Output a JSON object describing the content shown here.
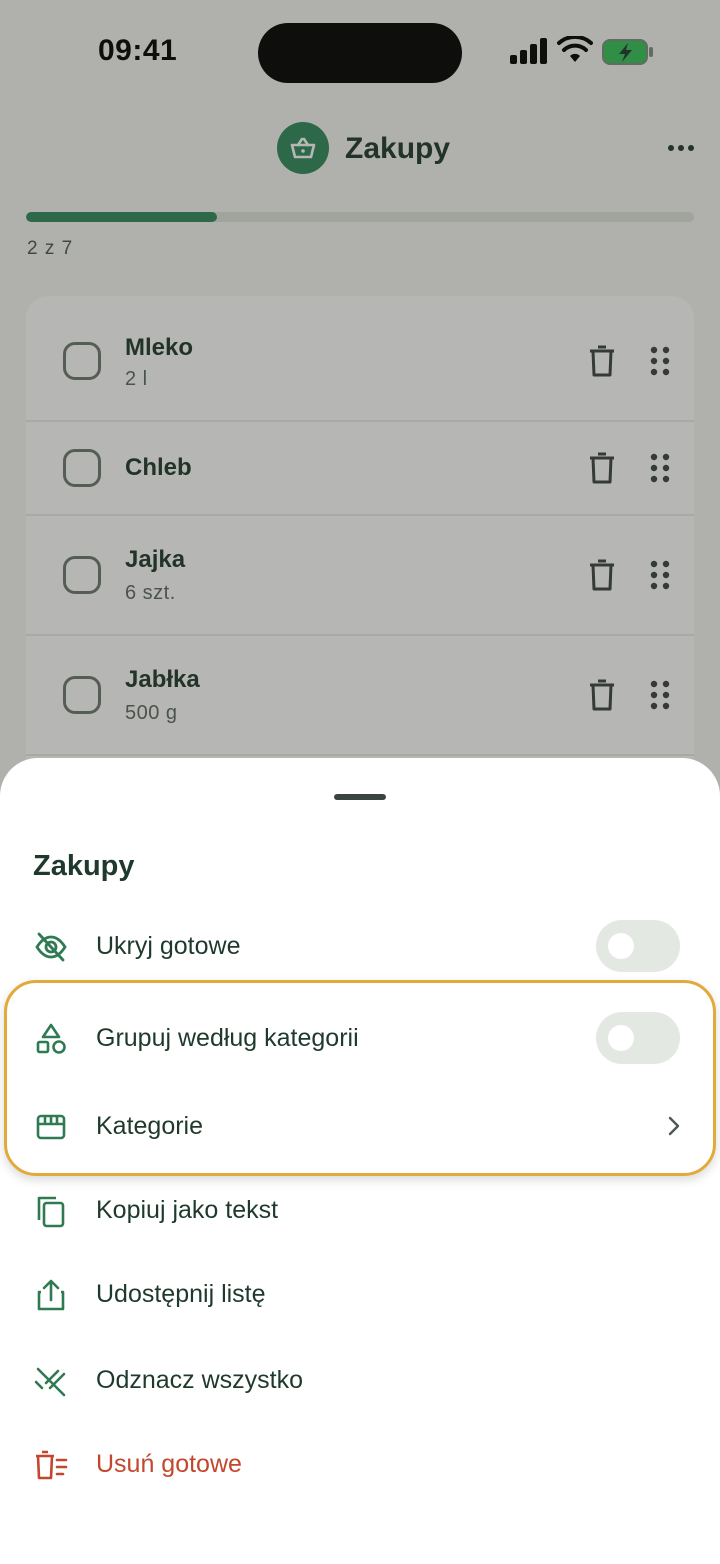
{
  "status_bar": {
    "time": "09:41",
    "icons": [
      "signal-icon",
      "wifi-icon",
      "battery-charging-icon"
    ]
  },
  "header": {
    "title": "Zakupy",
    "icon": "basket-icon",
    "menu_icon": "more-horizontal-icon"
  },
  "progress": {
    "text": "2 z 7",
    "done": 2,
    "total": 7
  },
  "list": {
    "items": [
      {
        "name": "Mleko",
        "qty": "2 l",
        "checked": false
      },
      {
        "name": "Chleb",
        "qty": "",
        "checked": false
      },
      {
        "name": "Jajka",
        "qty": "6 szt.",
        "checked": false
      },
      {
        "name": "Jabłka",
        "qty": "500 g",
        "checked": false
      }
    ],
    "row_icons": [
      "trash-icon",
      "drag-handle-icon"
    ]
  },
  "sheet": {
    "title": "Zakupy",
    "items": [
      {
        "label": "Ukryj gotowe",
        "icon": "eye-off-icon",
        "control": "toggle",
        "value": false
      },
      {
        "label": "Grupuj według kategorii",
        "icon": "shapes-icon",
        "control": "toggle",
        "value": false
      },
      {
        "label": "Kategorie",
        "icon": "store-icon",
        "control": "chevron"
      },
      {
        "label": "Kopiuj jako tekst",
        "icon": "copy-icon"
      },
      {
        "label": "Udostępnij listę",
        "icon": "share-icon"
      },
      {
        "label": "Odznacz wszystko",
        "icon": "uncheck-all-icon"
      },
      {
        "label": "Usuń gotowe",
        "icon": "delete-done-icon",
        "danger": true
      }
    ]
  },
  "colors": {
    "accent": "#2f8a5c",
    "text": "#1f3a2c",
    "danger": "#c3472d",
    "highlight": "#e2a93b"
  }
}
